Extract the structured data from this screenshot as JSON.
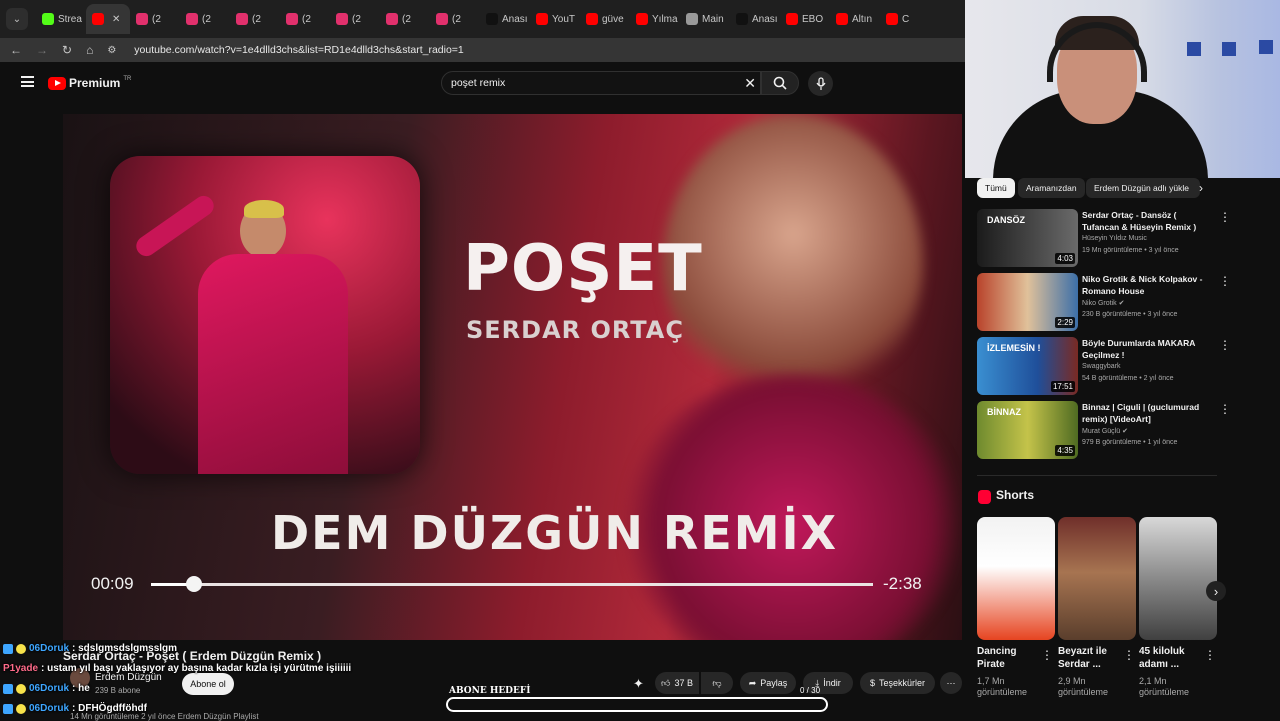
{
  "colors": {
    "yt_red": "#ff0000",
    "accent_blue": "#3ea6ff",
    "chat_yellow": "#f7e24b",
    "chat_pink": "#ff6b8a"
  },
  "browser": {
    "tabs": [
      {
        "label": "Strea",
        "favicon": "#53fc18"
      },
      {
        "label": "",
        "favicon": "#ff0000",
        "active": true
      },
      {
        "label": "(2",
        "favicon": "#e1306c"
      },
      {
        "label": "(2",
        "favicon": "#e1306c"
      },
      {
        "label": "(2",
        "favicon": "#e1306c"
      },
      {
        "label": "(2",
        "favicon": "#e1306c"
      },
      {
        "label": "(2",
        "favicon": "#e1306c"
      },
      {
        "label": "(2",
        "favicon": "#e1306c"
      },
      {
        "label": "(2",
        "favicon": "#e1306c"
      },
      {
        "label": "Anası",
        "favicon": "#111111"
      },
      {
        "label": "YouT",
        "favicon": "#ff0000"
      },
      {
        "label": "güve",
        "favicon": "#ff0000"
      },
      {
        "label": "Yılma",
        "favicon": "#ff0000"
      },
      {
        "label": "Main",
        "favicon": "#999999"
      },
      {
        "label": "Anası",
        "favicon": "#111111"
      },
      {
        "label": "EBO",
        "favicon": "#ff0000"
      },
      {
        "label": "Altın",
        "favicon": "#ff0000"
      },
      {
        "label": "C",
        "favicon": "#ff0000"
      }
    ],
    "url": "youtube.com/watch?v=1e4dlld3chs&list=RD1e4dlld3chs&start_radio=1"
  },
  "header": {
    "brand": "Premium",
    "brand_badge": "TR",
    "search_value": "poşet remix"
  },
  "video": {
    "art_title": "POŞET",
    "art_artist": "SERDAR ORTAÇ",
    "art_remix": "DEM DÜZGÜN REMİX",
    "time_current": "00:09",
    "time_remaining": "-2:38",
    "progress": 0.06
  },
  "under": {
    "title": "Serdar Ortaç - Poşet ( Erdem Düzgün Remix )",
    "channel": "Erdem Düzgün",
    "subs": "239 B abone",
    "subscribe_label": "Abone ol",
    "likes": "37 B",
    "share": "Paylaş",
    "download": "İndir",
    "thanks": "Teşekkürler",
    "meta": "14 Mn görüntüleme  2 yıl önce  Erdem Düzgün Playlist",
    "goal_label": "ABONE HEDEFİ",
    "goal_count": "0 / 30"
  },
  "chat": [
    {
      "user": "06Doruk",
      "text": ": sdslgmsdslgmsslgm",
      "color": "#3ea6ff"
    },
    {
      "user": "P1yade",
      "text": ": ustam yıl başı yaklaşıyor ay başına kadar kızla işi yürütme işiiiiii",
      "color": "#ff6b8a"
    },
    {
      "user": "06Doruk",
      "text": ": he",
      "color": "#3ea6ff"
    },
    {
      "user": "06Doruk",
      "text": ": DFHÖgdfföhdf",
      "color": "#3ea6ff"
    }
  ],
  "sidebar": {
    "chips": [
      "Tümü",
      "Aramanızdan",
      "Erdem Düzgün adlı yükle"
    ],
    "recs": [
      {
        "title": "Serdar Ortaç - Dansöz ( Tufancan & Hüseyin Remix )",
        "channel": "Hüseyin Yıldız Music",
        "stats": "19 Mn görüntüleme • 3 yıl önce",
        "duration": "4:03",
        "thumb_label": "DANSÖZ",
        "verified": false
      },
      {
        "title": "Niko Grotik & Nick Kolpakov - Romano House",
        "channel": "Niko Grotik",
        "stats": "230 B görüntüleme • 3 yıl önce",
        "duration": "2:29",
        "thumb_label": "",
        "verified": true
      },
      {
        "title": "Böyle Durumlarda MAKARA Geçilmez !",
        "channel": "Swaggybark",
        "stats": "54 B görüntüleme • 2 yıl önce",
        "duration": "17:51",
        "thumb_label": "İZLEMESİN !",
        "verified": false
      },
      {
        "title": "Binnaz | Ciguli | (guclumurad remix) [VideoArt]",
        "channel": "Murat Güçlü",
        "stats": "979 B görüntüleme • 1 yıl önce",
        "duration": "4:35",
        "thumb_label": "BİNNAZ",
        "verified": true
      }
    ],
    "shorts_title": "Shorts",
    "shorts": [
      {
        "title": "Dancing Pirate",
        "views": "1,7 Mn görüntüleme"
      },
      {
        "title": "Beyazıt ile Serdar ...",
        "views": "2,9 Mn görüntüleme"
      },
      {
        "title": "45 kiloluk adamı ...",
        "views": "2,1 Mn görüntüleme"
      }
    ]
  }
}
